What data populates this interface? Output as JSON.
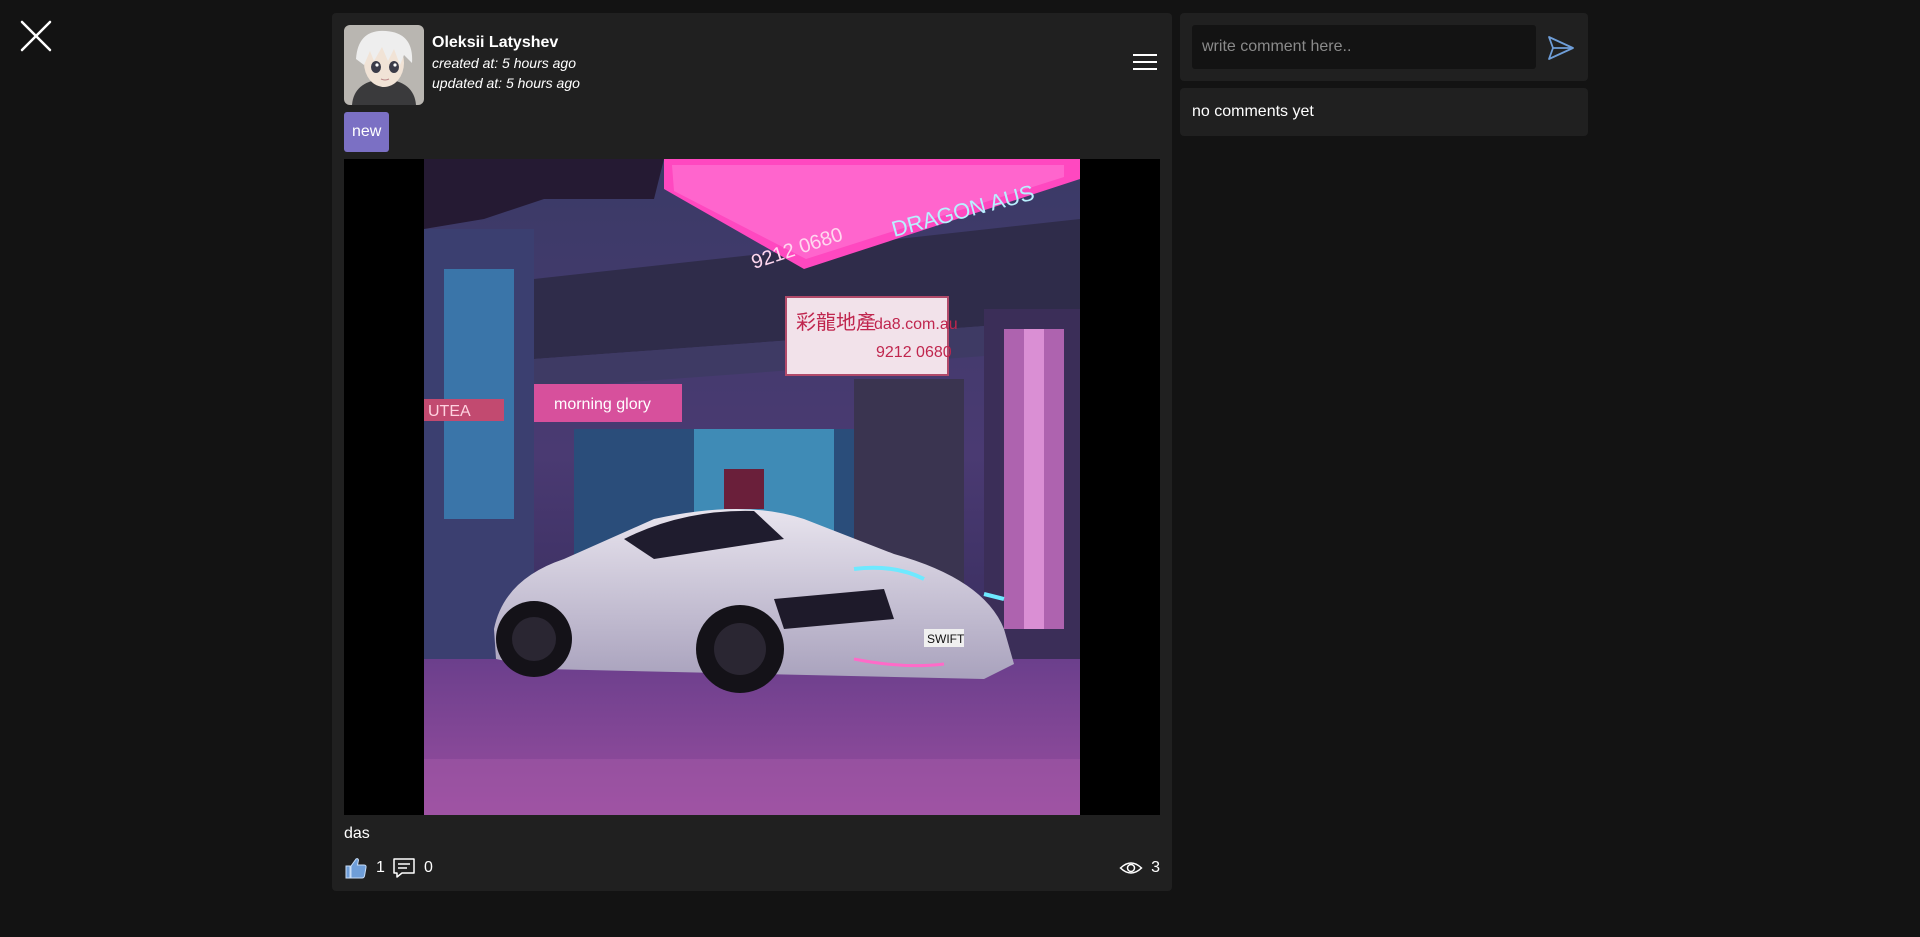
{
  "post": {
    "author": {
      "name": "Oleksii Latyshev",
      "created_at": "created at: 5 hours ago",
      "updated_at": "updated at: 5 hours ago"
    },
    "tag": "new",
    "text": "das",
    "likes": "1",
    "comments": "0",
    "views": "3"
  },
  "photo_signage": {
    "sign_1": "DRAGON AUS",
    "sign_2": "9212 0680",
    "sign_3_zh": "彩龍地產",
    "sign_3_web": "da8.com.au",
    "sign_3_phone": "9212 0680",
    "sign_4": "morning glory",
    "sign_5": "UTEA",
    "plate": "SWIFT"
  },
  "comments_panel": {
    "placeholder": "write comment here..",
    "empty_text": "no comments yet"
  },
  "icons": {
    "close": "close-icon",
    "menu": "hamburger-menu-icon",
    "like": "thumbs-up-icon",
    "comment": "comment-icon",
    "views": "eye-icon",
    "send": "send-icon"
  },
  "colors": {
    "background": "#131313",
    "panel": "#202020",
    "tag": "#7b70c4",
    "like_icon": "#6f9ed8",
    "send_icon": "#6f9ed8"
  }
}
